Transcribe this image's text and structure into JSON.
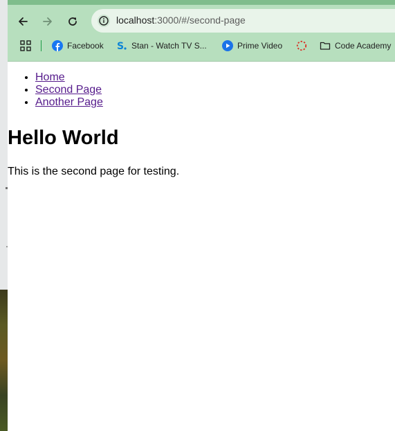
{
  "browser": {
    "url_host": "localhost",
    "url_path": ":3000/#/second-page",
    "bookmarks": [
      {
        "label": "Facebook",
        "icon": "facebook-icon"
      },
      {
        "label": "Stan - Watch TV S...",
        "icon": "stan-icon"
      },
      {
        "label": "Prime Video",
        "icon": "prime-video-icon"
      },
      {
        "label": "",
        "icon": "loading-circle-icon"
      },
      {
        "label": "Code Academy",
        "icon": "folder-icon"
      }
    ]
  },
  "page": {
    "nav": [
      {
        "label": "Home"
      },
      {
        "label": "Second Page"
      },
      {
        "label": "Another Page"
      }
    ],
    "heading": "Hello World",
    "paragraph": "This is the second page for testing."
  },
  "colors": {
    "toolbar_bg": "#b7dfbe",
    "tab_strip": "#7fbd8c",
    "omnibox_bg": "#e9f4ea",
    "visited_link": "#551a8b"
  }
}
